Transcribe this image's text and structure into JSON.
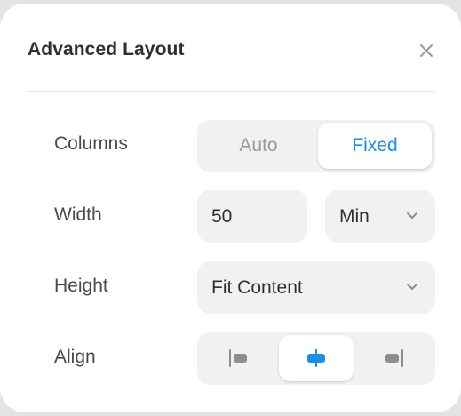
{
  "dialog": {
    "title": "Advanced Layout",
    "close_icon": "close-icon"
  },
  "columns": {
    "label": "Columns",
    "options": [
      "Auto",
      "Fixed"
    ],
    "selected": "Fixed"
  },
  "width": {
    "label": "Width",
    "value": "50",
    "unit": "Min"
  },
  "height": {
    "label": "Height",
    "value": "Fit Content"
  },
  "align": {
    "label": "Align",
    "options": [
      "align-left-icon",
      "align-center-icon",
      "align-right-icon"
    ],
    "selected": "align-center-icon"
  },
  "colors": {
    "accent": "#1a8ee8",
    "panel": "#ffffff",
    "backdrop": "#e4e4e4",
    "control_bg": "#f1f1f1",
    "icon_gray": "#8e8e8e"
  }
}
